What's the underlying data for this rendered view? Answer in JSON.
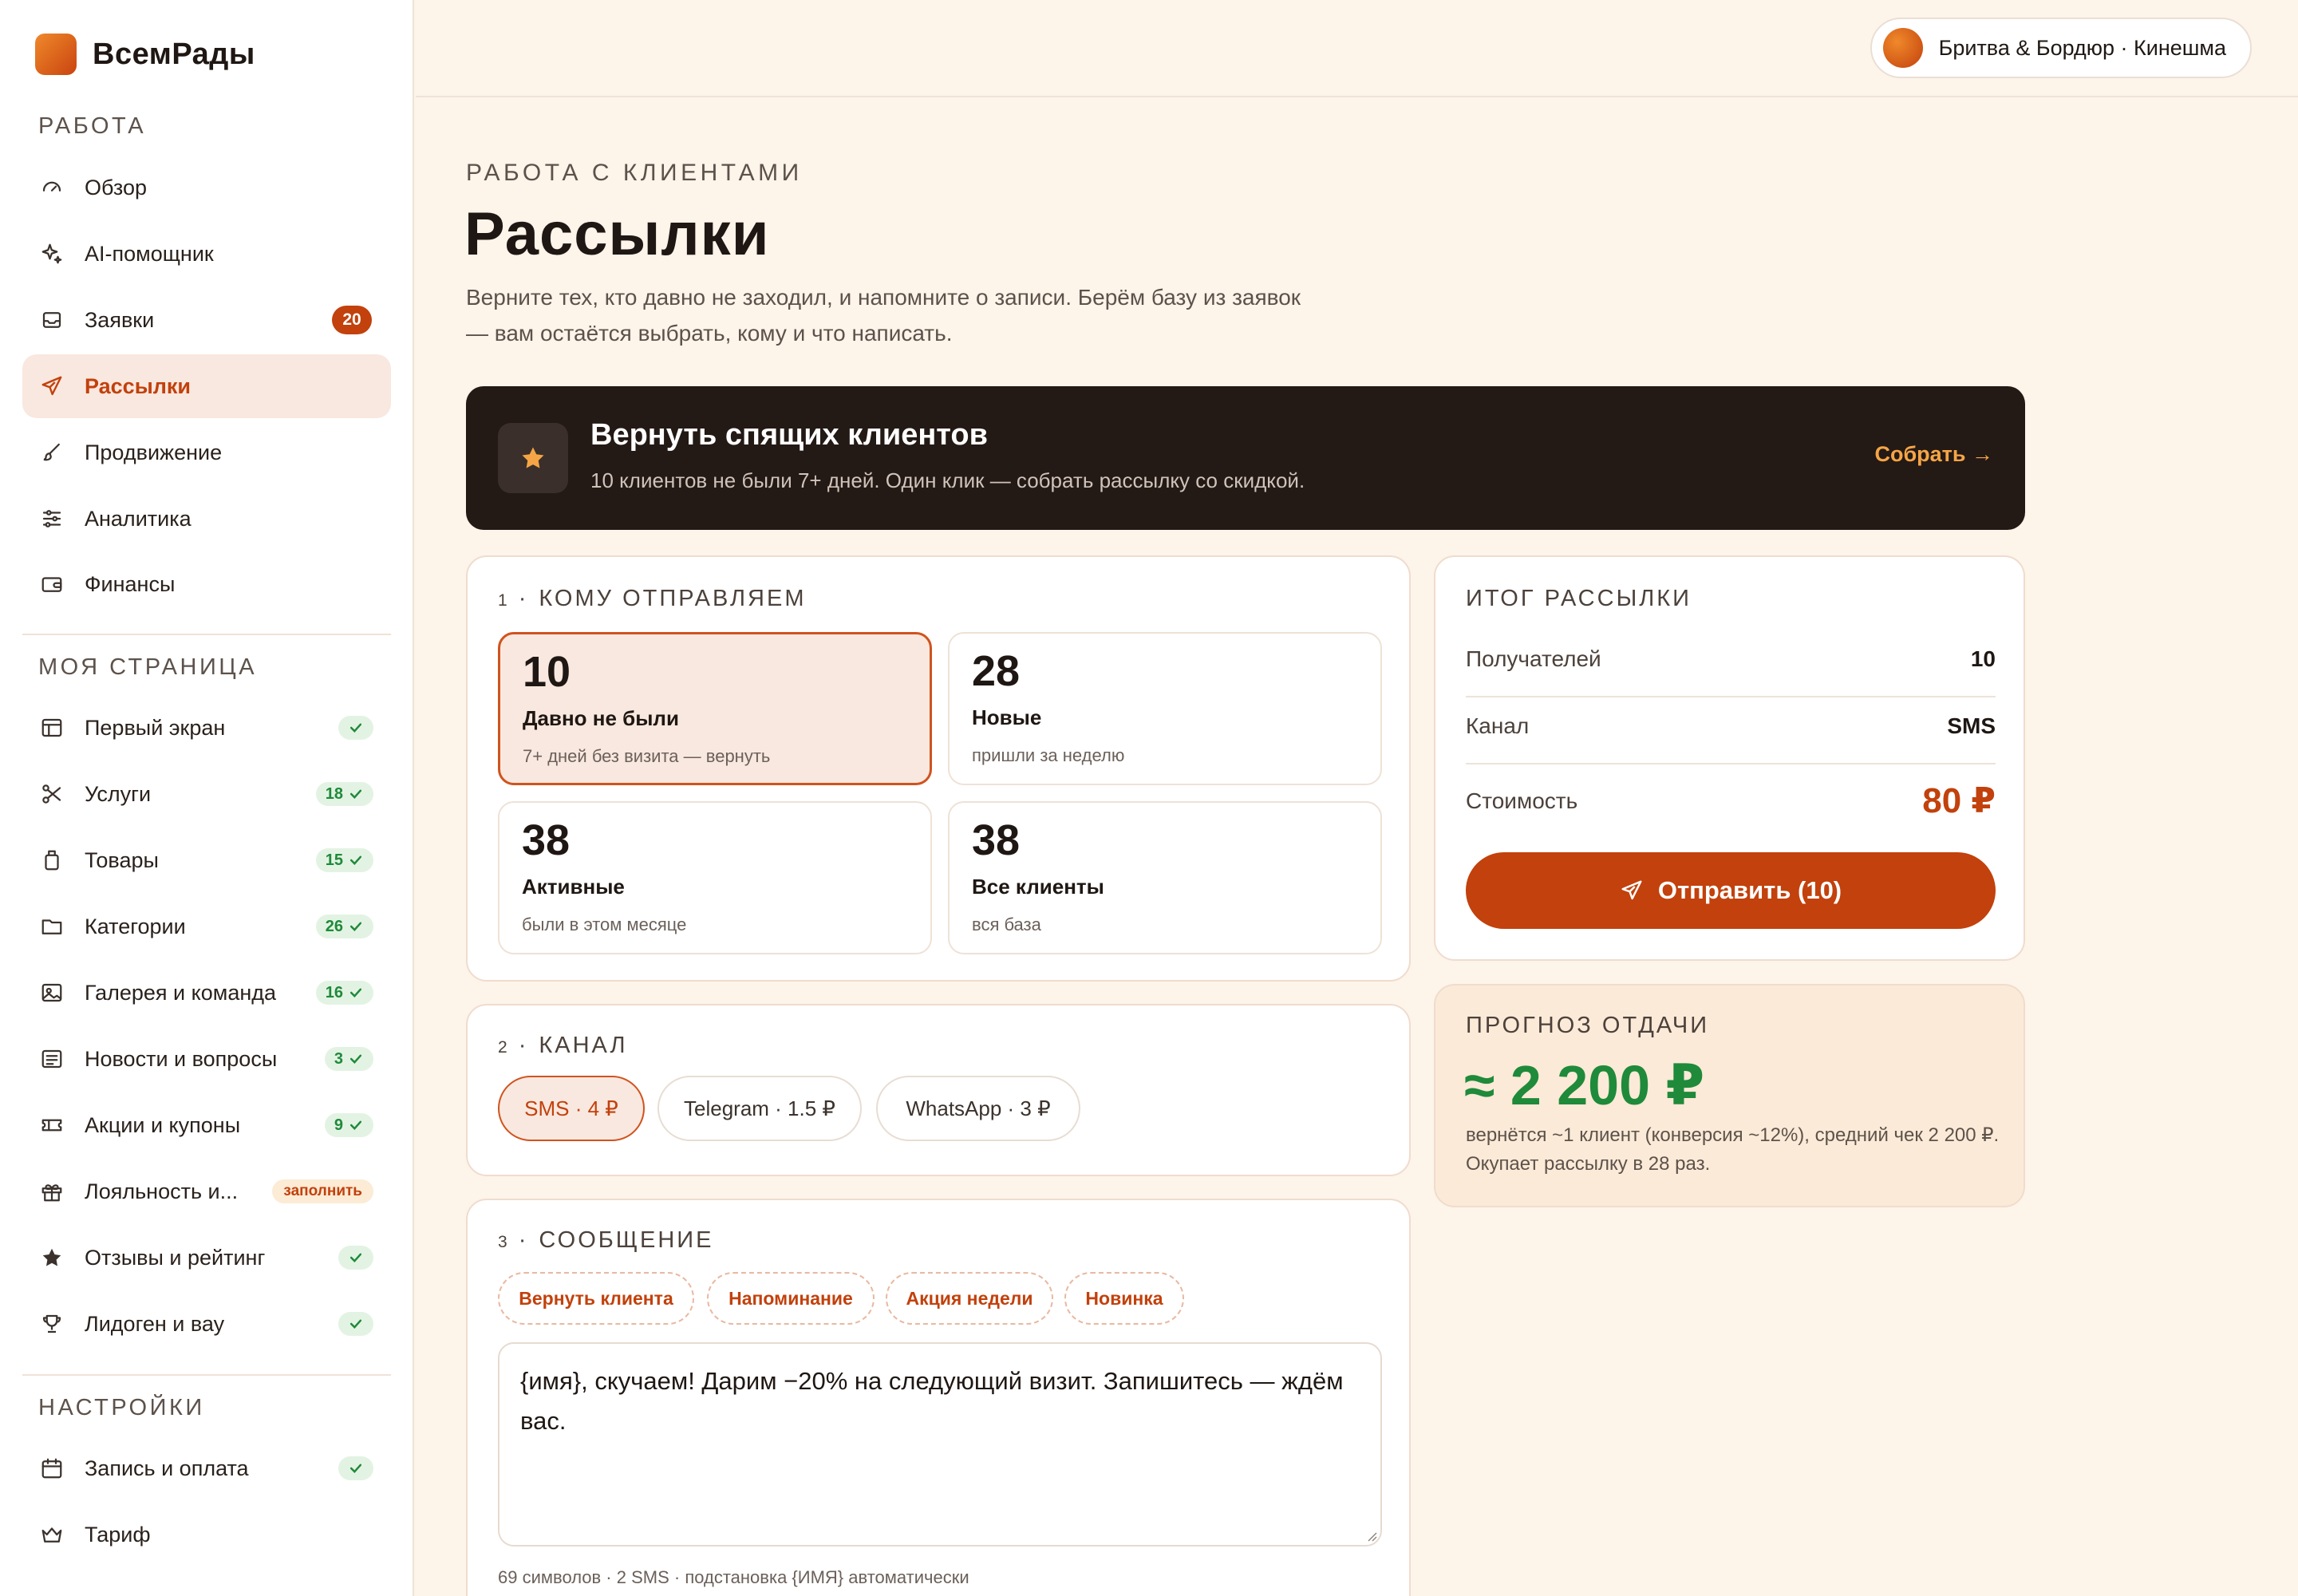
{
  "brand": {
    "name": "ВсемРады"
  },
  "sidebar": {
    "sections": [
      {
        "title": "РАБОТА"
      },
      {
        "title": "МОЯ СТРАНИЦА"
      },
      {
        "title": "НАСТРОЙКИ"
      }
    ],
    "items": [
      {
        "label": "Обзор",
        "icon": "gauge-icon"
      },
      {
        "label": "AI-помощник",
        "icon": "sparkle-icon"
      },
      {
        "label": "Заявки",
        "icon": "inbox-icon",
        "badge": "20"
      },
      {
        "label": "Рассылки",
        "icon": "send-icon",
        "active": true
      },
      {
        "label": "Продвижение",
        "icon": "brush-icon"
      },
      {
        "label": "Аналитика",
        "icon": "sliders-icon"
      },
      {
        "label": "Финансы",
        "icon": "wallet-icon"
      },
      {
        "label": "Первый экран",
        "icon": "layout-icon",
        "status": ""
      },
      {
        "label": "Услуги",
        "icon": "scissors-icon",
        "status": "18"
      },
      {
        "label": "Товары",
        "icon": "bottle-icon",
        "status": "15"
      },
      {
        "label": "Категории",
        "icon": "folder-icon",
        "status": "26"
      },
      {
        "label": "Галерея и команда",
        "icon": "image-icon",
        "status": "16"
      },
      {
        "label": "Новости и вопросы",
        "icon": "news-icon",
        "status": "3"
      },
      {
        "label": "Акции и купоны",
        "icon": "ticket-icon",
        "status": "9"
      },
      {
        "label": "Лояльность и...",
        "icon": "gift-icon",
        "fill": "заполнить"
      },
      {
        "label": "Отзывы и рейтинг",
        "icon": "star-icon",
        "status": ""
      },
      {
        "label": "Лидоген и вау",
        "icon": "trophy-icon",
        "status": ""
      },
      {
        "label": "Запись и оплата",
        "icon": "calendar-icon",
        "status": ""
      },
      {
        "label": "Тариф",
        "icon": "crown-icon"
      }
    ]
  },
  "header": {
    "business": "Бритва & Бордюр · Кинешма"
  },
  "page": {
    "kicker": "РАБОТА С КЛИЕНТАМИ",
    "title": "Рассылки",
    "description": "Верните тех, кто давно не заходил, и напомните о записи. Берём базу из заявок — вам остаётся выбрать, кому и что написать."
  },
  "promo": {
    "title": "Вернуть спящих клиентов",
    "subtitle": "10 клиентов не были 7+ дней. Один клик — собрать рассылку со скидкой.",
    "cta": "Собрать →"
  },
  "audience": {
    "step": "1",
    "title": "КОМУ ОТПРАВЛЯЕМ",
    "segments": [
      {
        "count": "10",
        "label": "Давно не были",
        "sub": "7+ дней без визита — вернуть",
        "selected": true
      },
      {
        "count": "28",
        "label": "Новые",
        "sub": "пришли за неделю"
      },
      {
        "count": "38",
        "label": "Активные",
        "sub": "были в этом месяце"
      },
      {
        "count": "38",
        "label": "Все клиенты",
        "sub": "вся база"
      }
    ]
  },
  "channel": {
    "step": "2",
    "title": "КАНАЛ",
    "options": [
      {
        "label": "SMS · 4 ₽",
        "selected": true
      },
      {
        "label": "Telegram · 1.5 ₽"
      },
      {
        "label": "WhatsApp · 3 ₽"
      }
    ]
  },
  "message": {
    "step": "3",
    "title": "СООБЩЕНИЕ",
    "templates": [
      "Вернуть клиента",
      "Напоминание",
      "Акция недели",
      "Новинка"
    ],
    "text": "{имя}, скучаем! Дарим −20% на следующий визит. Запишитесь — ждём вас.",
    "meta": "69 символов · 2 SMS · подстановка {ИМЯ} автоматически"
  },
  "summary": {
    "title": "ИТОГ РАССЫЛКИ",
    "recipients_label": "Получателей",
    "recipients_value": "10",
    "channel_label": "Канал",
    "channel_value": "SMS",
    "cost_label": "Стоимость",
    "cost_value": "80 ₽",
    "send_label": "Отправить (10)"
  },
  "forecast": {
    "title": "ПРОГНОЗ ОТДАЧИ",
    "value": "≈ 2 200 ₽",
    "description": "вернётся ~1 клиент (конверсия ~12%), средний чек 2 200 ₽. Окупает рассылку в 28 раз."
  },
  "colors": {
    "accent": "#c2410c",
    "dark": "#231915",
    "success": "#1f8a3a",
    "background": "#fdf4ea"
  }
}
